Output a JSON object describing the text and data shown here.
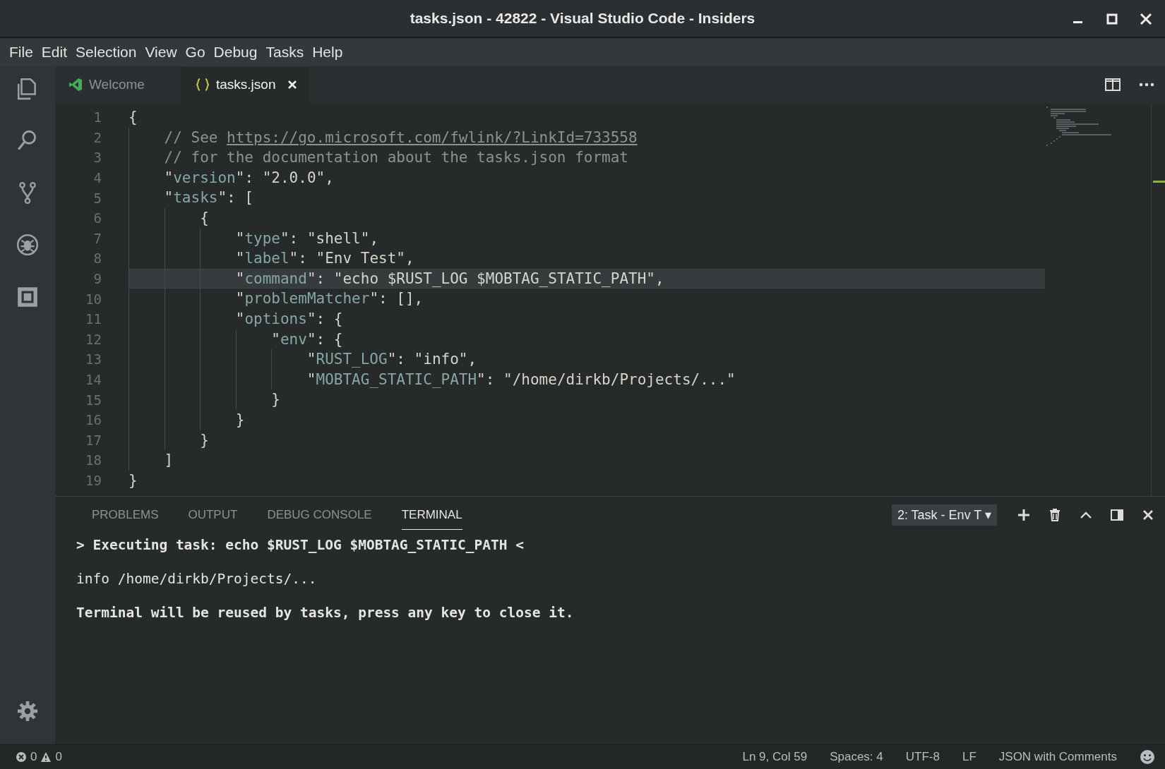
{
  "window": {
    "title": "tasks.json - 42822 - Visual Studio Code - Insiders"
  },
  "menu": [
    "File",
    "Edit",
    "Selection",
    "View",
    "Go",
    "Debug",
    "Tasks",
    "Help"
  ],
  "activity_bar": [
    {
      "kind": "files",
      "selected": false
    },
    {
      "kind": "search",
      "selected": false
    },
    {
      "kind": "scm",
      "selected": false
    },
    {
      "kind": "debug",
      "selected": false
    },
    {
      "kind": "extensions",
      "selected": false
    }
  ],
  "editor_tabs": [
    {
      "label": "Welcome",
      "kind": "welcome",
      "selected": false
    },
    {
      "label": "tasks.json",
      "kind": "json",
      "selected": true
    }
  ],
  "code_lines": [
    {
      "number": "1",
      "current": false,
      "tokens": [
        {
          "kind": "plain",
          "text": "{"
        }
      ]
    },
    {
      "number": "2",
      "current": false,
      "tokens": [
        {
          "kind": "comment",
          "text": "    // See "
        },
        {
          "kind": "link",
          "text": "https://go.microsoft.com/fwlink/?LinkId=733558"
        }
      ]
    },
    {
      "number": "3",
      "current": false,
      "tokens": [
        {
          "kind": "comment",
          "text": "    // for the documentation about the tasks.json format"
        }
      ]
    },
    {
      "number": "4",
      "current": false,
      "tokens": [
        {
          "kind": "plain",
          "text": "    \""
        },
        {
          "kind": "key",
          "text": "version"
        },
        {
          "kind": "plain",
          "text": "\": \"2.0.0\","
        }
      ]
    },
    {
      "number": "5",
      "current": false,
      "tokens": [
        {
          "kind": "plain",
          "text": "    \""
        },
        {
          "kind": "key",
          "text": "tasks"
        },
        {
          "kind": "plain",
          "text": "\": ["
        }
      ]
    },
    {
      "number": "6",
      "current": false,
      "tokens": [
        {
          "kind": "plain",
          "text": "        {"
        }
      ]
    },
    {
      "number": "7",
      "current": false,
      "tokens": [
        {
          "kind": "plain",
          "text": "            \""
        },
        {
          "kind": "key",
          "text": "type"
        },
        {
          "kind": "plain",
          "text": "\": \"shell\","
        }
      ]
    },
    {
      "number": "8",
      "current": false,
      "tokens": [
        {
          "kind": "plain",
          "text": "            \""
        },
        {
          "kind": "key",
          "text": "label"
        },
        {
          "kind": "plain",
          "text": "\": \"Env Test\","
        }
      ]
    },
    {
      "number": "9",
      "current": true,
      "tokens": [
        {
          "kind": "plain",
          "text": "            \""
        },
        {
          "kind": "key",
          "text": "command"
        },
        {
          "kind": "plain",
          "text": "\": \"echo $RUST_LOG $MOBTAG_STATIC_PATH\","
        }
      ]
    },
    {
      "number": "10",
      "current": false,
      "tokens": [
        {
          "kind": "plain",
          "text": "            \""
        },
        {
          "kind": "key",
          "text": "problemMatcher"
        },
        {
          "kind": "plain",
          "text": "\": [],"
        }
      ]
    },
    {
      "number": "11",
      "current": false,
      "tokens": [
        {
          "kind": "plain",
          "text": "            \""
        },
        {
          "kind": "key",
          "text": "options"
        },
        {
          "kind": "plain",
          "text": "\": {"
        }
      ]
    },
    {
      "number": "12",
      "current": false,
      "tokens": [
        {
          "kind": "plain",
          "text": "                \""
        },
        {
          "kind": "key",
          "text": "env"
        },
        {
          "kind": "plain",
          "text": "\": {"
        }
      ]
    },
    {
      "number": "13",
      "current": false,
      "tokens": [
        {
          "kind": "plain",
          "text": "                    \""
        },
        {
          "kind": "key",
          "text": "RUST_LOG"
        },
        {
          "kind": "plain",
          "text": "\": \"info\","
        }
      ]
    },
    {
      "number": "14",
      "current": false,
      "tokens": [
        {
          "kind": "plain",
          "text": "                    \""
        },
        {
          "kind": "key",
          "text": "MOBTAG_STATIC_PATH"
        },
        {
          "kind": "plain",
          "text": "\": \"/home/dirkb/Projects/...\""
        }
      ]
    },
    {
      "number": "15",
      "current": false,
      "tokens": [
        {
          "kind": "plain",
          "text": "                }"
        }
      ]
    },
    {
      "number": "16",
      "current": false,
      "tokens": [
        {
          "kind": "plain",
          "text": "            }"
        }
      ]
    },
    {
      "number": "17",
      "current": false,
      "tokens": [
        {
          "kind": "plain",
          "text": "        }"
        }
      ]
    },
    {
      "number": "18",
      "current": false,
      "tokens": [
        {
          "kind": "plain",
          "text": "    ]"
        }
      ]
    },
    {
      "number": "19",
      "current": false,
      "tokens": [
        {
          "kind": "plain",
          "text": "}"
        }
      ]
    }
  ],
  "panel_tabs": [
    {
      "label": "PROBLEMS",
      "selected": false
    },
    {
      "label": "OUTPUT",
      "selected": false
    },
    {
      "label": "DEBUG CONSOLE",
      "selected": false
    },
    {
      "label": "TERMINAL",
      "selected": true
    }
  ],
  "terminal_select": {
    "value": "2: Task - Env T",
    "caret": "▾"
  },
  "terminal_lines": [
    {
      "text": "> Executing task: echo $RUST_LOG $MOBTAG_STATIC_PATH <",
      "bold": true
    },
    {
      "text": "info /home/dirkb/Projects/...",
      "bold": false
    },
    {
      "text": "Terminal will be reused by tasks, press any key to close it.",
      "bold": true
    }
  ],
  "status_bar": {
    "errors": "0",
    "warnings": "0",
    "items": [
      "Ln 9, Col 59",
      "Spaces: 4",
      "UTF-8",
      "LF",
      "JSON with Comments"
    ]
  }
}
